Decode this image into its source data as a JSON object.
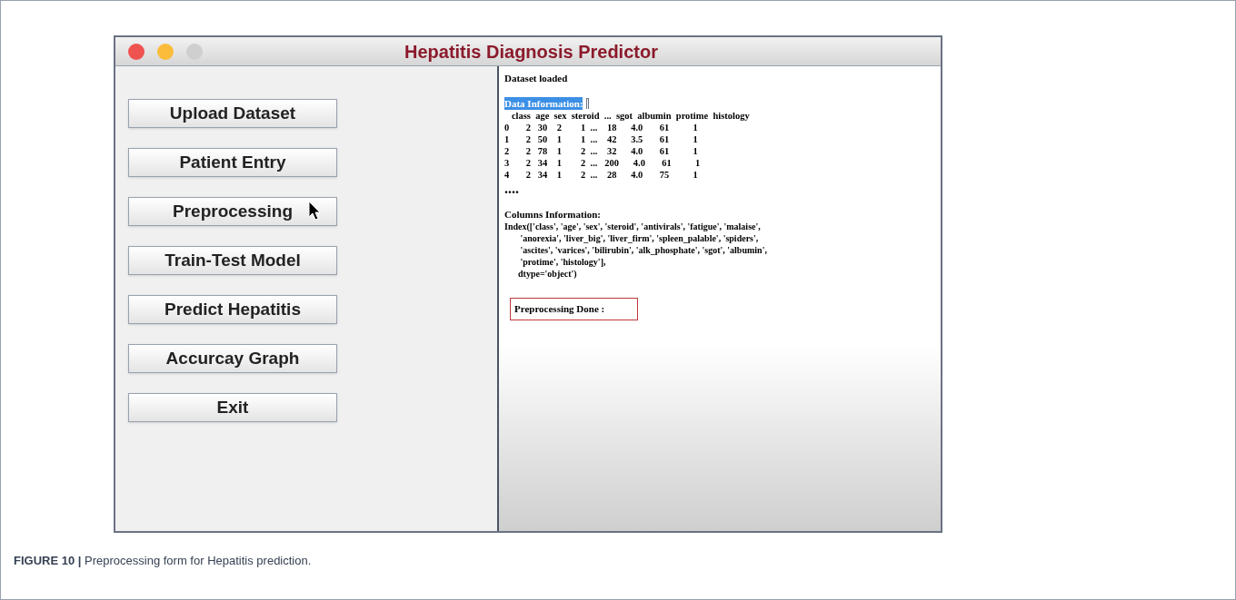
{
  "window": {
    "title": "Hepatitis Diagnosis Predictor"
  },
  "buttons": [
    {
      "label": "Upload Dataset"
    },
    {
      "label": "Patient Entry"
    },
    {
      "label": "Preprocessing"
    },
    {
      "label": "Train-Test Model"
    },
    {
      "label": "Predict Hepatitis"
    },
    {
      "label": "Accurcay Graph"
    },
    {
      "label": "Exit"
    }
  ],
  "output": {
    "status": "Dataset loaded",
    "data_heading": {
      "text": "Data Information:",
      "selected": true
    },
    "data_table": [
      "   class  age  sex  steroid  ...  sgot  albumin  protime  histology",
      "0       2   30    2        1  ...    18      4.0       61          1",
      "1       2   50    1        1  ...    42      3.5       61          1",
      "2       2   78    1        2  ...    32      4.0       61          1",
      "3       2   34    1        2  ...   200      4.0       61          1",
      "4       2   34    1        2  ...    28      4.0       75          1"
    ],
    "ellipsis": "....",
    "columns_heading": "Columns Information:",
    "columns_index": [
      "Index(['class', 'age', 'sex', 'steroid', 'antivirals', 'fatigue', 'malaise',",
      "       'anorexia', 'liver_big', 'liver_firm', 'spleen_palable', 'spiders',",
      "       'ascites', 'varices', 'bilirubin', 'alk_phosphate', 'sgot', 'albumin',",
      "       'protime', 'histology'],",
      "      dtype='object')"
    ],
    "result": "Preprocessing Done :"
  },
  "caption": {
    "label": "FIGURE 10 |",
    "text": "Preprocessing form for Hepatitis prediction."
  }
}
